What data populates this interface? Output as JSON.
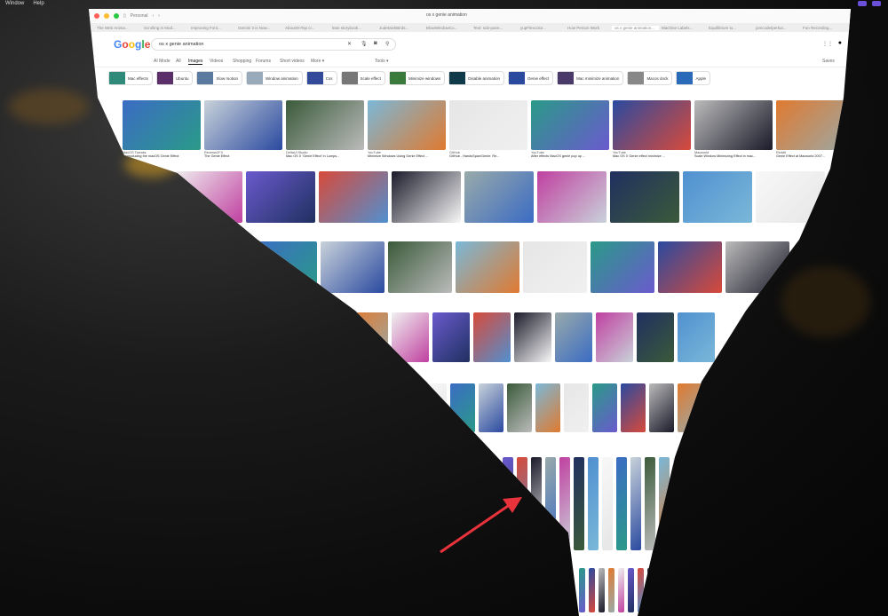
{
  "menubar": {
    "items": [
      "Window",
      "Help"
    ]
  },
  "browser": {
    "profile": "Personal",
    "address": "os x genie animation",
    "tabs": [
      "The Web Anima...",
      "Scrolling in Mod...",
      "Improving Font...",
      "Gemini 3 is Now...",
      "AboutOnTop cr...",
      "lean storybook...",
      "JudeDarkBirds...",
      "BlowWindowCo...",
      "Text: sub-pane...",
      "yupFlexcolor...",
      "How Person Work",
      "os x genie animation...",
      "Machine Labels...",
      "Equilibrium to...",
      "jomcode/perkut...",
      "Fun Recording..."
    ]
  },
  "google": {
    "logo": "Google",
    "query": "os x genie animation",
    "nav": [
      "AI Mode",
      "All",
      "Images",
      "Videos",
      "Shopping",
      "Forums",
      "Short videos",
      "More ▾"
    ],
    "tools": "Tools ▾",
    "saves": "Saves",
    "chips": [
      "Mac effects",
      "Ubuntu",
      "Slow motion",
      "Window animation",
      "Css",
      "Scale effect",
      "Minimize windows",
      "Disable animation",
      "Genie effect",
      "Mac minimize animation",
      "Macos dock",
      "Apple"
    ],
    "row1_captions": [
      {
        "source": "MacOS Tweaks",
        "title": "Reproducing the macOS Genie Effect"
      },
      {
        "source": "Reverse2FX",
        "title": "The Genie Effect"
      },
      {
        "source": "DeltaUI Studio",
        "title": "Mac OS X 'Genie Effect' in Lumps..."
      },
      {
        "source": "YouTube",
        "title": "Minimize Windows Using Genie Effect ..."
      },
      {
        "source": "GitHub",
        "title": "GitHub - HandsSpan/Genie: Re..."
      },
      {
        "source": "YouTube",
        "title": "After effects MacOS genie pop up ..."
      },
      {
        "source": "YouTube",
        "title": "Mac OS X Genie effect minimize ..."
      },
      {
        "source": "Macworld",
        "title": "Scale Window Minimizing Effect in mac..."
      },
      {
        "source": "Reddit",
        "title": "Genie Effect at Macworld 2007..."
      }
    ]
  },
  "colors": {
    "arrow": "#e8323c",
    "close": "#ff5f57",
    "min": "#febc2e",
    "max": "#28c840"
  }
}
